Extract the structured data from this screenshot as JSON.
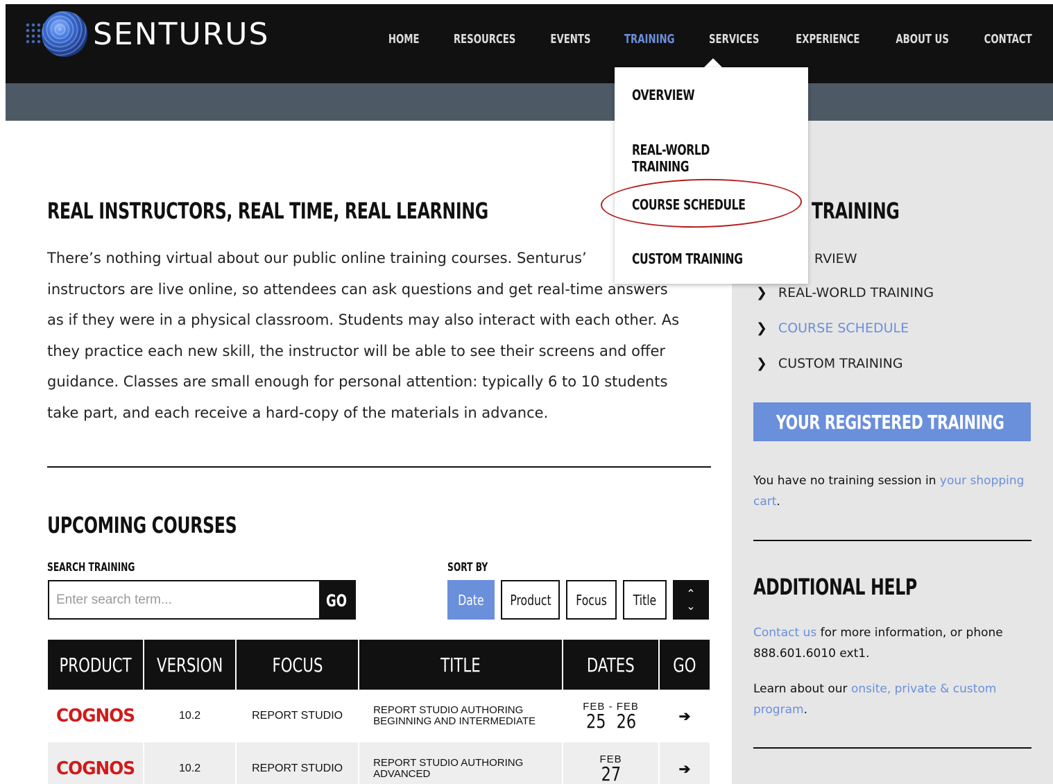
{
  "header": {
    "logo_text": "SENTURUS",
    "nav": [
      {
        "label": "HOME",
        "active": false
      },
      {
        "label": "RESOURCES",
        "active": false
      },
      {
        "label": "EVENTS",
        "active": false
      },
      {
        "label": "TRAINING",
        "active": true
      },
      {
        "label": "SERVICES",
        "active": false
      },
      {
        "label": "EXPERIENCE",
        "active": false
      },
      {
        "label": "ABOUT US",
        "active": false
      },
      {
        "label": "CONTACT",
        "active": false
      }
    ]
  },
  "dropdown": {
    "items": [
      "OVERVIEW",
      "REAL-WORLD TRAINING",
      "COURSE SCHEDULE",
      "CUSTOM TRAINING"
    ],
    "highlighted": "COURSE SCHEDULE"
  },
  "main": {
    "title": "REAL INSTRUCTORS, REAL TIME, REAL LEARNING",
    "intro_lines": [
      "There’s nothing virtual about our public online training courses. Senturus’",
      "instructors are live online, so attendees can ask questions and get real-time answers",
      "as if they were in a physical classroom. Students may also interact with each other. As",
      "they practice each new skill, the instructor will be able to see their screens and offer",
      "guidance. Classes are small enough for personal attention: typically 6 to 10 students",
      "take part, and each receive a hard-copy of the materials in advance."
    ],
    "upcoming_title": "UPCOMING COURSES",
    "search": {
      "label": "SEARCH TRAINING",
      "placeholder": "Enter search term...",
      "go_label": "GO"
    },
    "sort": {
      "label": "SORT BY",
      "options": [
        "Date",
        "Product",
        "Focus",
        "Title"
      ],
      "active": "Date"
    },
    "table": {
      "headers": [
        "PRODUCT",
        "VERSION",
        "FOCUS",
        "TITLE",
        "DATES",
        "GO"
      ],
      "rows": [
        {
          "product": "COGNOS",
          "version": "10.2",
          "focus": "REPORT STUDIO",
          "title_line1": "REPORT STUDIO AUTHORING",
          "title_line2": "BEGINNING AND INTERMEDIATE",
          "month": "FEB - FEB",
          "days": "25 26"
        },
        {
          "product": "COGNOS",
          "version": "10.2",
          "focus": "REPORT STUDIO",
          "title_line1": "REPORT STUDIO AUTHORING",
          "title_line2": "ADVANCED",
          "month": "FEB",
          "days": "27"
        }
      ],
      "go_icon": "arrow-right-icon"
    }
  },
  "sidebar": {
    "title": "TRAINING",
    "items": [
      {
        "label": "RVIEW",
        "active": false
      },
      {
        "label": "REAL-WORLD TRAINING",
        "active": false
      },
      {
        "label": "COURSE SCHEDULE",
        "active": true
      },
      {
        "label": "CUSTOM TRAINING",
        "active": false
      }
    ],
    "registered_button": "YOUR REGISTERED TRAINING",
    "cart_text_pre": "You have no training session in ",
    "cart_link": "your shopping cart",
    "cart_text_post": ".",
    "help_title": "ADDITIONAL HELP",
    "contact_link": "Contact us",
    "contact_text": " for more information, or phone 888.601.6010 ext1.",
    "learn_pre": "Learn about our ",
    "learn_link": "onsite, private & custom program",
    "learn_post": "."
  },
  "colors": {
    "accent": "#6a8fdb",
    "header_bg": "#111111",
    "subbar_bg": "#4d5a66",
    "sidebar_bg": "#e6e6e6",
    "brand_red": "#d11a1a",
    "highlight_oval": "#b51c1c"
  }
}
